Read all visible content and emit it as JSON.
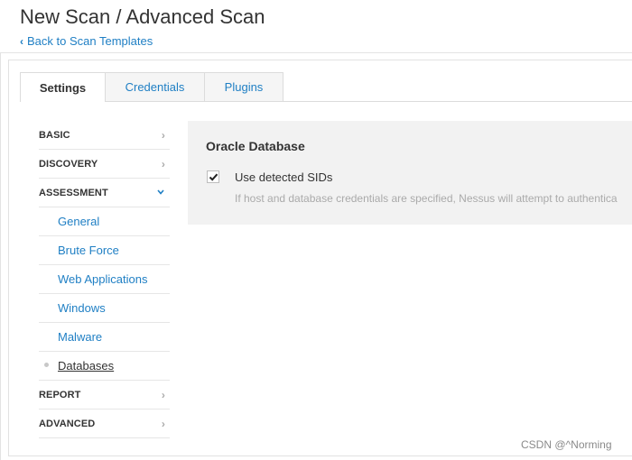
{
  "header": {
    "title": "New Scan / Advanced Scan",
    "back_link": "Back to Scan Templates"
  },
  "tabs": [
    {
      "label": "Settings",
      "active": true
    },
    {
      "label": "Credentials",
      "active": false
    },
    {
      "label": "Plugins",
      "active": false
    }
  ],
  "sidebar": {
    "items": [
      {
        "label": "BASIC",
        "type": "section",
        "icon": "chevron-right-icon"
      },
      {
        "label": "DISCOVERY",
        "type": "section",
        "icon": "chevron-right-icon"
      },
      {
        "label": "ASSESSMENT",
        "type": "section",
        "expanded": true,
        "icon": "chevron-down-icon"
      },
      {
        "label": "General",
        "type": "sub"
      },
      {
        "label": "Brute Force",
        "type": "sub"
      },
      {
        "label": "Web Applications",
        "type": "sub"
      },
      {
        "label": "Windows",
        "type": "sub"
      },
      {
        "label": "Malware",
        "type": "sub"
      },
      {
        "label": "Databases",
        "type": "sub",
        "current": true
      },
      {
        "label": "REPORT",
        "type": "section",
        "icon": "chevron-right-icon"
      },
      {
        "label": "ADVANCED",
        "type": "section",
        "icon": "chevron-right-icon"
      }
    ]
  },
  "panel": {
    "title": "Oracle Database",
    "option_label": "Use detected SIDs",
    "option_checked": true,
    "help_text": "If host and database credentials are specified, Nessus will attempt to authentica"
  },
  "watermark": "CSDN @^Norming",
  "colors": {
    "link": "#1f7fc4",
    "panel_bg": "#f2f2f2",
    "text": "#333333",
    "muted": "#aaaaaa"
  }
}
